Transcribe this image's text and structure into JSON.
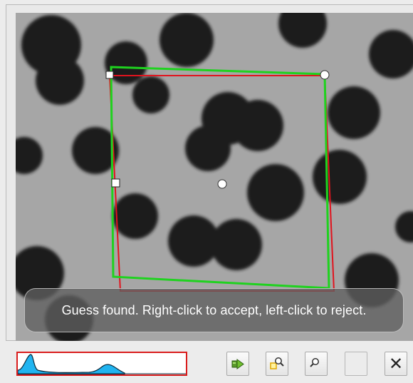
{
  "status_message": "Guess found. Right-click to accept, left-click to reject.",
  "colors": {
    "detected_outline": "#1fd21f",
    "reference_outline": "#e0141e",
    "histogram_fill": "#20b4f0",
    "histogram_border": "#d91c1c"
  },
  "toolbar": {
    "buttons": [
      {
        "icon": "accept-arrow-icon",
        "label": ""
      },
      {
        "icon": "zoom-region-icon",
        "label": ""
      },
      {
        "icon": "zoom-icon",
        "label": ""
      },
      {
        "icon": "blank-icon",
        "label": ""
      },
      {
        "icon": "close-icon",
        "label": "✕"
      }
    ]
  }
}
